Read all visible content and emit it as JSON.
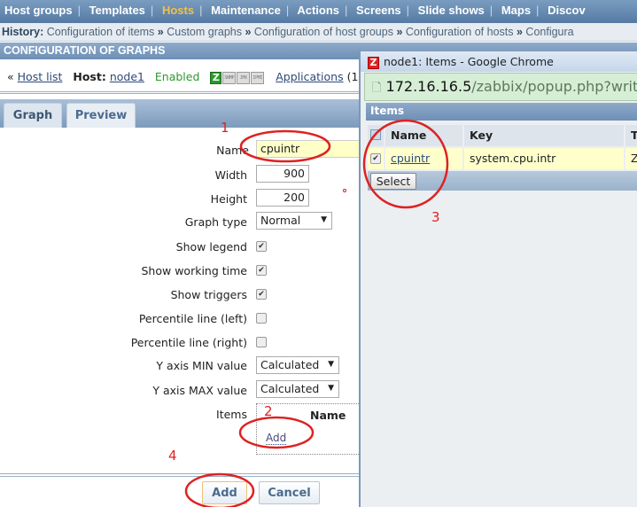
{
  "nav": {
    "items": [
      "Host groups",
      "Templates",
      "Hosts",
      "Maintenance",
      "Actions",
      "Screens",
      "Slide shows",
      "Maps",
      "Discov"
    ],
    "active": "Hosts"
  },
  "history": {
    "label": "History:",
    "items": [
      "Configuration of items",
      "Custom graphs",
      "Configuration of host groups",
      "Configuration of hosts",
      "Configura"
    ],
    "separator": "»"
  },
  "page_title": "CONFIGURATION OF GRAPHS",
  "host_line": {
    "back": "«",
    "host_list": "Host list",
    "host_label": "Host:",
    "host": "node1",
    "status": "Enabled",
    "icons": [
      "Z",
      "SNMP",
      "JMX",
      "IPMI"
    ],
    "applications": "Applications",
    "applications_suffix": "(1"
  },
  "tabs": [
    {
      "label": "Graph",
      "selected": true
    },
    {
      "label": "Preview",
      "selected": false
    }
  ],
  "form": {
    "name_label": "Name",
    "name_value": "cpuintr",
    "width_label": "Width",
    "width_value": "900",
    "height_label": "Height",
    "height_value": "200",
    "graph_type_label": "Graph type",
    "graph_type_value": "Normal",
    "show_legend_label": "Show legend",
    "show_legend": true,
    "show_working_time_label": "Show working time",
    "show_working_time": true,
    "show_triggers_label": "Show triggers",
    "show_triggers": true,
    "percentile_left_label": "Percentile line (left)",
    "percentile_left": false,
    "percentile_right_label": "Percentile line (right)",
    "percentile_right": false,
    "ymin_label": "Y axis MIN value",
    "ymin_value": "Calculated",
    "ymax_label": "Y axis MAX value",
    "ymax_value": "Calculated",
    "items_label": "Items",
    "items_name_header": "Name",
    "items_add": "Add",
    "add_button": "Add",
    "cancel_button": "Cancel"
  },
  "popup": {
    "title": "node1: Items - Google Chrome",
    "url_host": "172.16.16.5",
    "url_path": "/zabbix/popup.php?writec",
    "section": "Items",
    "columns": [
      "Name",
      "Key",
      "Ty"
    ],
    "rows": [
      {
        "checked": true,
        "name": "cpuintr",
        "key": "system.cpu.intr",
        "type": "Za"
      }
    ],
    "select_button": "Select"
  },
  "annotations": [
    "1",
    "2",
    "3",
    "4"
  ],
  "colors": {
    "annotation": "#dd2222",
    "nav_active": "#f3c14a",
    "enabled": "#2a9a2a"
  }
}
